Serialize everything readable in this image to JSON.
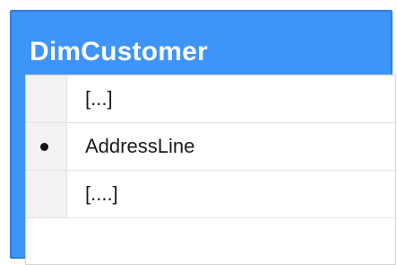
{
  "table": {
    "title": "DimCustomer",
    "rows": [
      {
        "label": "[...]"
      },
      {
        "label": "AddressLine"
      },
      {
        "label": "[....]"
      }
    ]
  },
  "colors": {
    "header_blue": "#3f94f7",
    "row_header_gray": "#f2f2f2"
  },
  "icons": {
    "row_marker": "bullet-dot-icon"
  }
}
